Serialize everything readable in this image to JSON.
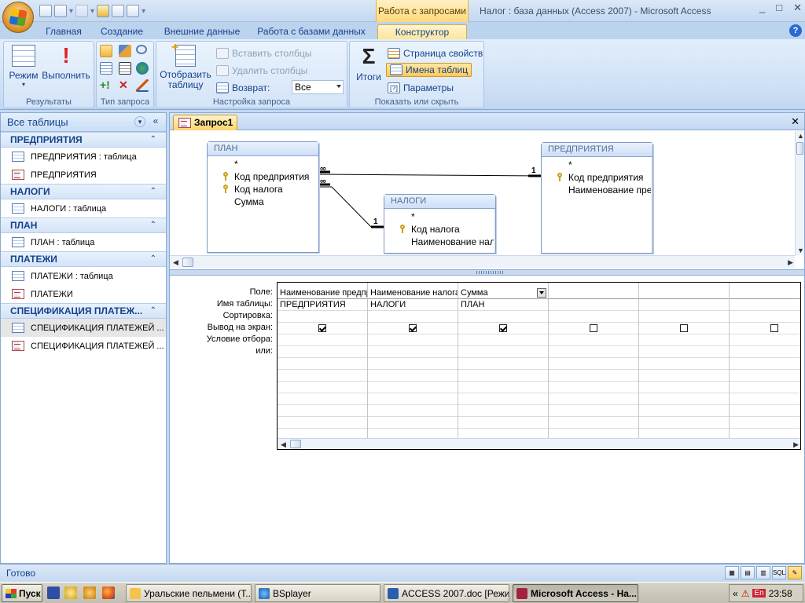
{
  "title_bar": {
    "context_tab_title": "Работа с запросами",
    "app_title": "Налог : база данных (Access 2007) - Microsoft Access",
    "controls": [
      "_",
      "□",
      "✕"
    ]
  },
  "ribbon_tabs": [
    {
      "label": "Главная",
      "active": false
    },
    {
      "label": "Создание",
      "active": false
    },
    {
      "label": "Внешние данные",
      "active": false
    },
    {
      "label": "Работа с базами данных",
      "active": false
    },
    {
      "label": "Конструктор",
      "active": true
    }
  ],
  "help_label": "?",
  "ribbon": {
    "results": {
      "label": "Результаты",
      "mode": "Режим",
      "run": "Выполнить"
    },
    "query_type": {
      "label": "Тип запроса"
    },
    "setup": {
      "label": "Настройка запроса",
      "show_table": "Отобразить таблицу",
      "insert_columns": "Вставить столбцы",
      "delete_columns": "Удалить столбцы",
      "return_label": "Возврат:",
      "return_value": "Все"
    },
    "show_hide": {
      "label": "Показать или скрыть",
      "totals": "Итоги",
      "property_sheet": "Страница свойств",
      "table_names": "Имена таблиц",
      "parameters": "Параметры"
    }
  },
  "nav": {
    "header": "Все таблицы",
    "groups": [
      {
        "title": "ПРЕДПРИЯТИЯ",
        "items": [
          {
            "label": "ПРЕДПРИЯТИЯ : таблица",
            "kind": "table",
            "selected": false
          },
          {
            "label": "ПРЕДПРИЯТИЯ",
            "kind": "query",
            "selected": false
          }
        ]
      },
      {
        "title": "НАЛОГИ",
        "items": [
          {
            "label": "НАЛОГИ : таблица",
            "kind": "table",
            "selected": false
          }
        ]
      },
      {
        "title": "ПЛАН",
        "items": [
          {
            "label": "ПЛАН : таблица",
            "kind": "table",
            "selected": false
          }
        ]
      },
      {
        "title": "ПЛАТЕЖИ",
        "items": [
          {
            "label": "ПЛАТЕЖИ : таблица",
            "kind": "table",
            "selected": false
          },
          {
            "label": "ПЛАТЕЖИ",
            "kind": "query",
            "selected": false
          }
        ]
      },
      {
        "title": "СПЕЦИФИКАЦИЯ ПЛАТЕЖ...",
        "items": [
          {
            "label": "СПЕЦИФИКАЦИЯ ПЛАТЕЖЕЙ ...",
            "kind": "table",
            "selected": true
          },
          {
            "label": "СПЕЦИФИКАЦИЯ ПЛАТЕЖЕЙ ...",
            "kind": "query",
            "selected": false
          }
        ]
      }
    ]
  },
  "document": {
    "tab_label": "Запрос1",
    "close": "✕"
  },
  "tables": {
    "plan": {
      "title": "ПЛАН",
      "fields": [
        {
          "name": "*",
          "key": false
        },
        {
          "name": "Код предприятия",
          "key": true
        },
        {
          "name": "Код налога",
          "key": true
        },
        {
          "name": "Сумма",
          "key": false
        }
      ]
    },
    "nalogi": {
      "title": "НАЛОГИ",
      "fields": [
        {
          "name": "*",
          "key": false
        },
        {
          "name": "Код налога",
          "key": true
        },
        {
          "name": "Наименование налога",
          "key": false
        }
      ]
    },
    "predpr": {
      "title": "ПРЕДПРИЯТИЯ",
      "fields": [
        {
          "name": "*",
          "key": false
        },
        {
          "name": "Код предприятия",
          "key": true
        },
        {
          "name": "Наименование предприятия",
          "key": false
        }
      ]
    }
  },
  "relations": {
    "one": "1",
    "many": "∞"
  },
  "qbe": {
    "row_labels": [
      "Поле:",
      "Имя таблицы:",
      "Сортировка:",
      "Вывод на экран:",
      "Условие отбора:",
      "или:"
    ],
    "columns": [
      {
        "field": "Наименование предприятия",
        "table": "ПРЕДПРИЯТИЯ",
        "show": true,
        "dropdown": false
      },
      {
        "field": "Наименование налога",
        "table": "НАЛОГИ",
        "show": true,
        "dropdown": false
      },
      {
        "field": "Сумма",
        "table": "ПЛАН",
        "show": true,
        "dropdown": true
      },
      {
        "field": "",
        "table": "",
        "show": false,
        "dropdown": false
      },
      {
        "field": "",
        "table": "",
        "show": false,
        "dropdown": false
      },
      {
        "field": "",
        "table": "",
        "show": false,
        "dropdown": false
      }
    ]
  },
  "status": {
    "text": "Готово",
    "views": [
      "▦",
      "▤",
      "▥",
      "SQL",
      "✎"
    ]
  },
  "taskbar": {
    "start": "Пуск",
    "tasks": [
      {
        "label": "Уральские пельмени (Т...",
        "active": false
      },
      {
        "label": "BSplayer",
        "active": false
      },
      {
        "label": "ACCESS 2007.doc [Режи...",
        "active": false
      },
      {
        "label": "Microsoft Access - На...",
        "active": true
      }
    ],
    "tray_arrow": "«",
    "lang": "En",
    "time": "23:58"
  }
}
